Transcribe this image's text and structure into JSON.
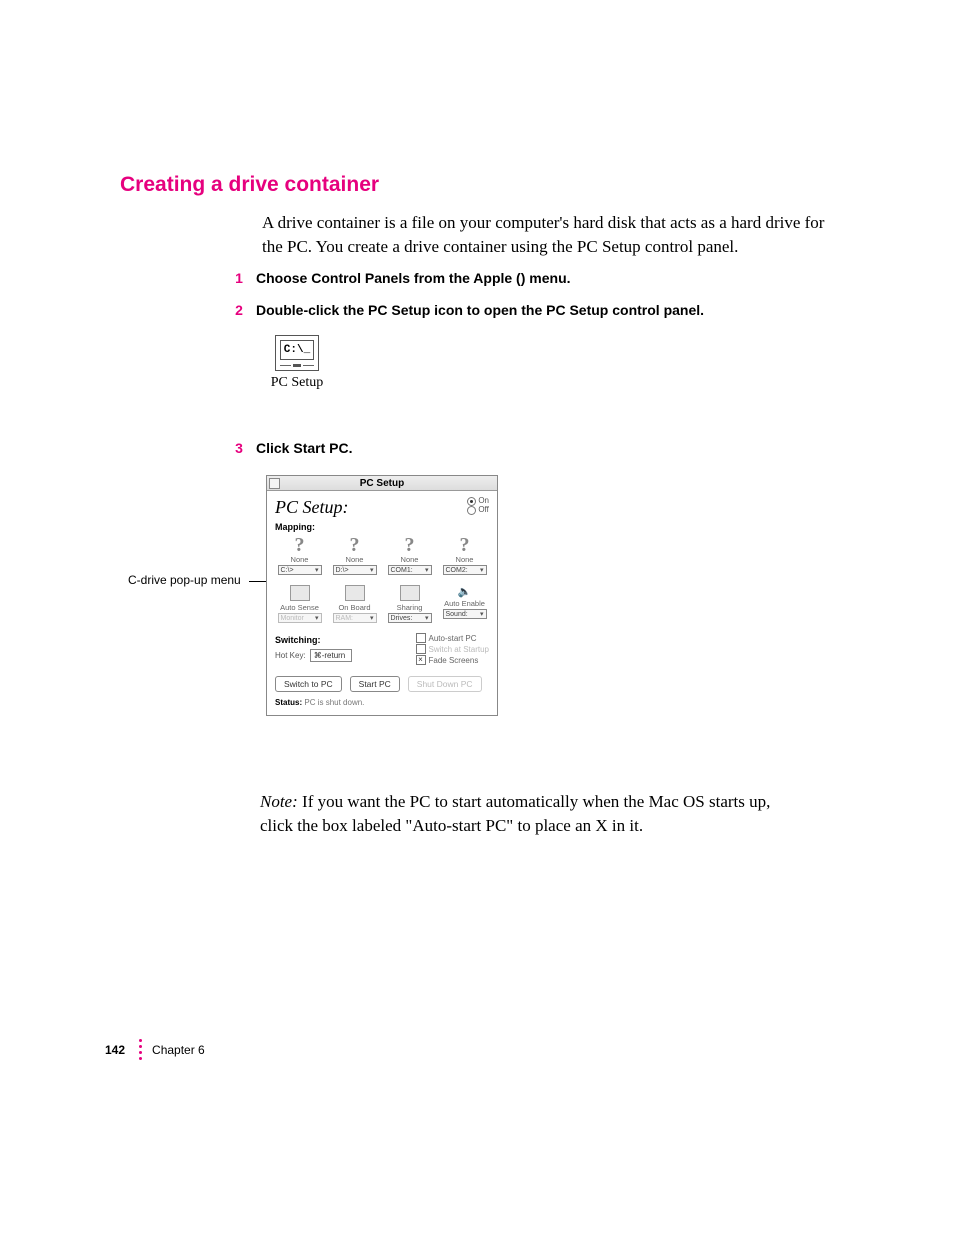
{
  "section_title": "Creating a drive container",
  "intro": "A drive container is a file on your computer's hard disk that acts as a hard drive for the PC. You create a drive container using the PC Setup control panel.",
  "steps": {
    "s1": {
      "num": "1",
      "text_before": "Choose Control Panels from the Apple (",
      "text_after": ") menu."
    },
    "s2": {
      "num": "2",
      "text": "Double-click the PC Setup icon to open the PC Setup control panel."
    },
    "s3": {
      "num": "3",
      "text": "Click Start PC."
    }
  },
  "pcsetup_icon": {
    "inner_label": "C:\\_",
    "caption": "PC Setup"
  },
  "callout": "C-drive pop-up menu",
  "cp": {
    "title": "PC Setup",
    "h1": "PC Setup:",
    "radio_on": "On",
    "radio_off": "Off",
    "mapping_label": "Mapping:",
    "mapping": [
      {
        "caption": "None",
        "dd": "C:\\>"
      },
      {
        "caption": "None",
        "dd": "D:\\>"
      },
      {
        "caption": "None",
        "dd": "COM1:"
      },
      {
        "caption": "None",
        "dd": "COM2:"
      }
    ],
    "options": [
      {
        "caption": "Auto Sense",
        "dd": "Monitor",
        "disabled": true
      },
      {
        "caption": "On Board",
        "dd": "RAM:",
        "disabled": true
      },
      {
        "caption": "Sharing",
        "dd": "Drives:",
        "disabled": false
      },
      {
        "caption": "Auto Enable",
        "dd": "Sound:",
        "disabled": false
      }
    ],
    "switching_label": "Switching:",
    "hotkey_label": "Hot Key:",
    "hotkey_value": "⌘-return",
    "checks": {
      "auto_start": "Auto-start PC",
      "switch_startup": "Switch at Startup",
      "fade_screens": "Fade Screens"
    },
    "buttons": {
      "switch": "Switch to PC",
      "start": "Start PC",
      "shutdown": "Shut Down PC"
    },
    "status_label": "Status:",
    "status_value": "PC is shut down."
  },
  "note": {
    "lead": "Note:",
    "text": "  If you want the PC to start automatically when the Mac OS starts up, click the box labeled \"Auto-start PC\" to place an X in it."
  },
  "footer": {
    "page": "142",
    "chapter": "Chapter 6"
  }
}
